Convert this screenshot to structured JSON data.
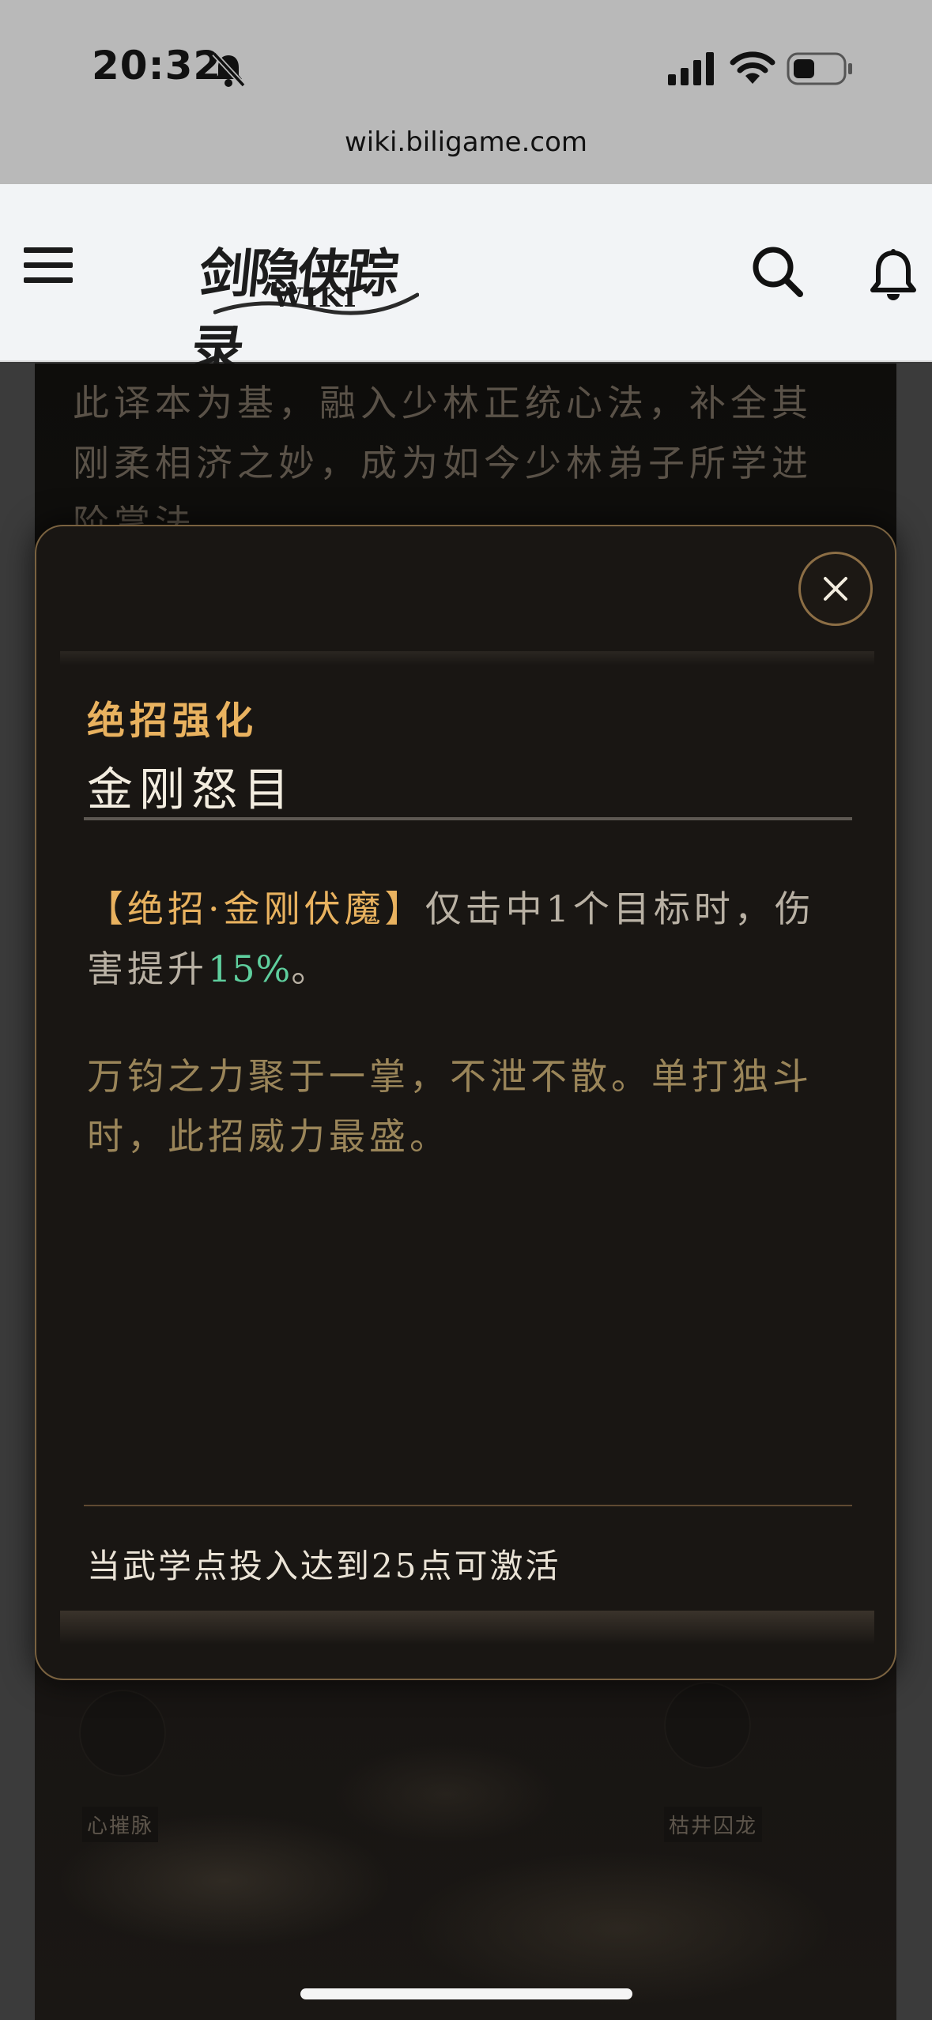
{
  "status_bar": {
    "time": "20:32",
    "url": "wiki.biligame.com"
  },
  "header": {
    "logo_title": "剑隐侠踪录",
    "logo_subtitle": "WIKI",
    "icons": [
      "menu-icon",
      "search-icon",
      "bell-icon"
    ]
  },
  "background_page": {
    "paragraph": "此译本为基，融入少林正统心法，补全其刚柔相济之妙，成为如今少林弟子所学进阶掌法。",
    "nodes": [
      "心摧脉",
      "枯井囚龙"
    ]
  },
  "modal": {
    "category": "绝招强化",
    "skill_name": "金刚怒目",
    "effect": {
      "skill_ref": "【绝招·金刚伏魔】",
      "text_before": "仅击中1个目标时，伤害提升",
      "percent": "15%",
      "text_after": "。"
    },
    "flavor": "万钧之力聚于一掌，不泄不散。单打独斗时，此招威力最盛。",
    "requirement": "当武学点投入达到25点可激活",
    "close_icon": "close-icon"
  },
  "colors": {
    "accent_gold": "#e9b25f",
    "percent_green": "#5fcf9e",
    "modal_border": "#7a6240"
  }
}
